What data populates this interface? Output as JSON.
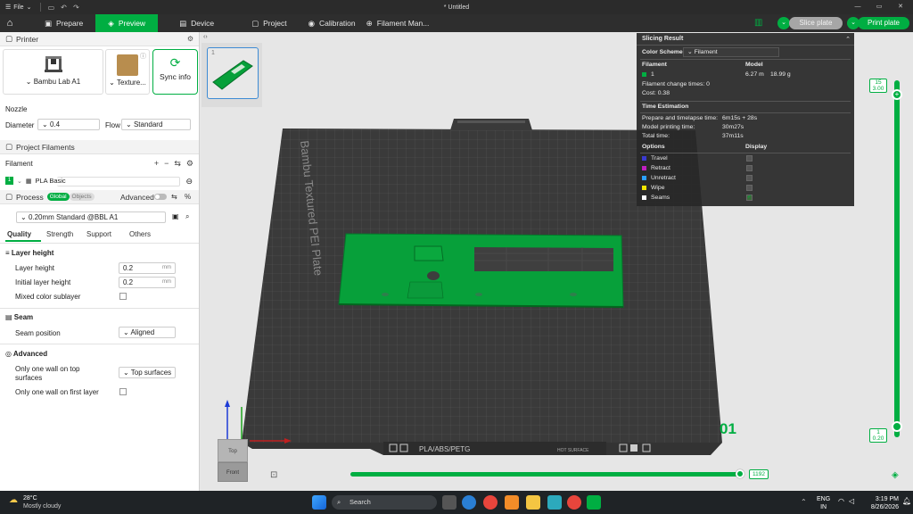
{
  "titlebar": {
    "file_menu": "File",
    "title": "* Untitled"
  },
  "menubar": {
    "tabs": [
      {
        "label": "Prepare",
        "active": false
      },
      {
        "label": "Preview",
        "active": true
      },
      {
        "label": "Device",
        "active": false
      },
      {
        "label": "Project",
        "active": false
      },
      {
        "label": "Calibration",
        "active": false
      },
      {
        "label": "Filament Man...",
        "active": false
      }
    ],
    "slice_plate": "Slice plate",
    "print_plate": "Print plate"
  },
  "printer": {
    "header": "Printer",
    "printer_name": "Bambu Lab A1",
    "plate_type": "Texture...",
    "sync_label": "Sync info",
    "nozzle_label": "Nozzle",
    "diameter_label": "Diameter",
    "diameter_value": "0.4",
    "flow_label": "Flow",
    "flow_value": "Standard"
  },
  "filaments": {
    "header": "Project Filaments",
    "column_label": "Filament",
    "items": [
      {
        "index": "1",
        "name": "PLA Basic",
        "color": "#00ae42"
      }
    ]
  },
  "process": {
    "header": "Process",
    "global_label": "Global",
    "objects_label": "Objects",
    "advanced_label": "Advanced",
    "preset": "0.20mm Standard @BBL A1",
    "tabs": [
      "Quality",
      "Strength",
      "Support",
      "Others"
    ],
    "groups": {
      "layer_height": {
        "title": "Layer height",
        "layer_height_label": "Layer height",
        "layer_height_value": "0.2",
        "initial_layer_label": "Initial layer height",
        "initial_layer_value": "0.2",
        "unit": "mm",
        "mixed_label": "Mixed color sublayer"
      },
      "seam": {
        "title": "Seam",
        "position_label": "Seam position",
        "position_value": "Aligned"
      },
      "advanced": {
        "title": "Advanced",
        "one_wall_top_label": "Only one wall on top surfaces",
        "one_wall_top_value": "Top surfaces",
        "one_wall_first_label": "Only one wall on first layer"
      }
    }
  },
  "slicing_result": {
    "title": "Slicing Result",
    "color_scheme_label": "Color Scheme",
    "color_scheme_value": "Filament",
    "filament_col": "Filament",
    "model_col": "Model",
    "filament_index": "1",
    "model_length": "6.27 m",
    "model_weight": "18.99 g",
    "change_times": "Filament change times:  0",
    "cost": "Cost:  0.38",
    "time_title": "Time Estimation",
    "prepare_label": "Prepare and timelapse time:",
    "prepare_value": "6m15s + 28s",
    "model_print_label": "Model printing time:",
    "model_print_value": "30m27s",
    "total_label": "Total time:",
    "total_value": "37m11s",
    "options_col": "Options",
    "display_col": "Display",
    "options": [
      {
        "label": "Travel",
        "color": "#3a3ad0",
        "checked": false
      },
      {
        "label": "Retract",
        "color": "#c020c0",
        "checked": false
      },
      {
        "label": "Unretract",
        "color": "#2ba0ff",
        "checked": false
      },
      {
        "label": "Wipe",
        "color": "#f2e600",
        "checked": false
      },
      {
        "label": "Seams",
        "color": "#ffffff",
        "checked": true
      }
    ]
  },
  "plate": {
    "bed_label": "Bambu Textured PEI Plate",
    "plate_number": "01",
    "thumb_index": "1",
    "strip_label": "PLA/ABS/PETG",
    "hot_surface": "HOT SURFACE"
  },
  "layers": {
    "top_layer": "15",
    "top_height": "3.00",
    "bottom_layer": "1",
    "bottom_height": "0.20",
    "move_value": "1192",
    "move_fraction": 0.99
  },
  "view_cube": {
    "top": "Top",
    "front": "Front"
  },
  "taskbar": {
    "weather_temp": "28°C",
    "weather_desc": "Mostly cloudy",
    "search_label": "Search",
    "lang": "ENG",
    "region": "IN",
    "time": "3:19 PM",
    "date": "8/26/2026"
  },
  "colors": {
    "accent": "#00ae42",
    "model": "#07a03a",
    "bed": "#3a3a3a"
  }
}
